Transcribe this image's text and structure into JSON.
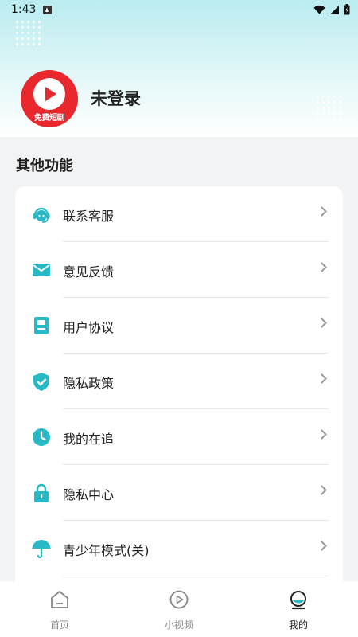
{
  "status_bar": {
    "time": "1:43"
  },
  "profile": {
    "avatar_text": "免费短剧",
    "name": "未登录"
  },
  "section": {
    "title": "其他功能"
  },
  "menu": [
    {
      "label": "联系客服",
      "icon": "headset-icon"
    },
    {
      "label": "意见反馈",
      "icon": "mail-icon"
    },
    {
      "label": "用户协议",
      "icon": "document-icon"
    },
    {
      "label": "隐私政策",
      "icon": "shield-check-icon"
    },
    {
      "label": "我的在追",
      "icon": "clock-icon"
    },
    {
      "label": "隐私中心",
      "icon": "lock-icon"
    },
    {
      "label": "青少年模式(关)",
      "icon": "umbrella-icon"
    }
  ],
  "bottom_nav": [
    {
      "label": "首页",
      "icon": "home-icon",
      "active": false
    },
    {
      "label": "小视频",
      "icon": "play-circle-icon",
      "active": false
    },
    {
      "label": "我的",
      "icon": "profile-icon",
      "active": true
    }
  ],
  "colors": {
    "accent": "#29b8c6",
    "avatar_red": "#e8282c",
    "header_gradient_top": "#b9ecf0"
  }
}
